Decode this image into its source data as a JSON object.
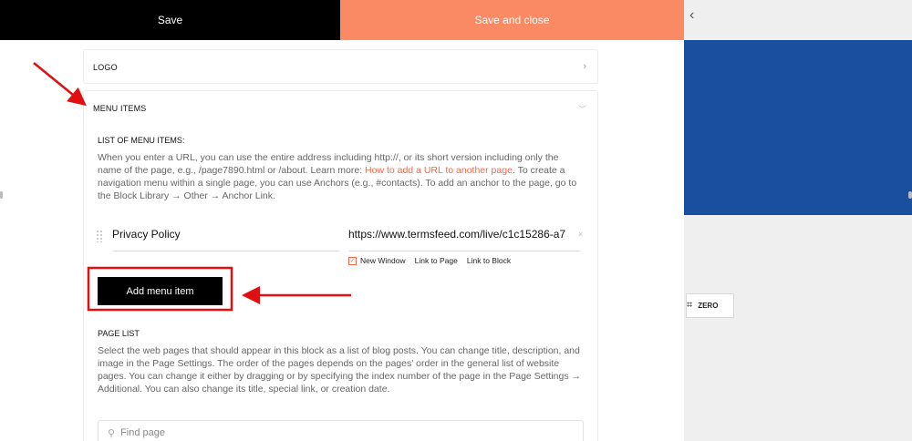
{
  "topbar": {
    "save_label": "Save",
    "save_close_label": "Save and close"
  },
  "preview": {
    "collapse_glyph": "‹",
    "zero_label": "ZERO",
    "zero_icon": "crop-icon"
  },
  "panels": {
    "logo": {
      "title": "LOGO"
    },
    "menu_items": {
      "title": "MENU ITEMS",
      "list_label": "LIST OF MENU ITEMS:",
      "desc_part1": "When you enter a URL, you can use the entire address including http://, or its short version including only the name of the page, e.g., /page7890.html or /about. Learn more: ",
      "desc_link": "How to add a URL to another page",
      "desc_part2": ". To create a navigation menu within a single page, you can use Anchors (e.g., #contacts). To add an anchor to the page, go to the Block Library → Other → Anchor Link.",
      "item": {
        "title": "Privacy Policy",
        "url": "https://www.termsfeed.com/live/c1c15286-a7",
        "new_window_label": "New Window",
        "new_window_checked": true,
        "link_to_page_label": "Link to Page",
        "link_to_block_label": "Link to Block"
      },
      "add_button_label": "Add menu item",
      "page_list_label": "PAGE LIST",
      "page_list_desc": "Select the web pages that should appear in this block as a list of blog posts. You can change title, description, and image in the Page Settings. The order of the pages depends on the pages' order in the general list of website pages. You can change it either by dragging or by specifying the index number of the page in the Page Settings → Additional. You can also change its title, special link, or creation date.",
      "search_placeholder": "Find page"
    }
  },
  "colors": {
    "accent": "#fa8a64",
    "link": "#f26a4a",
    "annotation": "#e01010",
    "preview_blue": "#1a4fa0"
  }
}
